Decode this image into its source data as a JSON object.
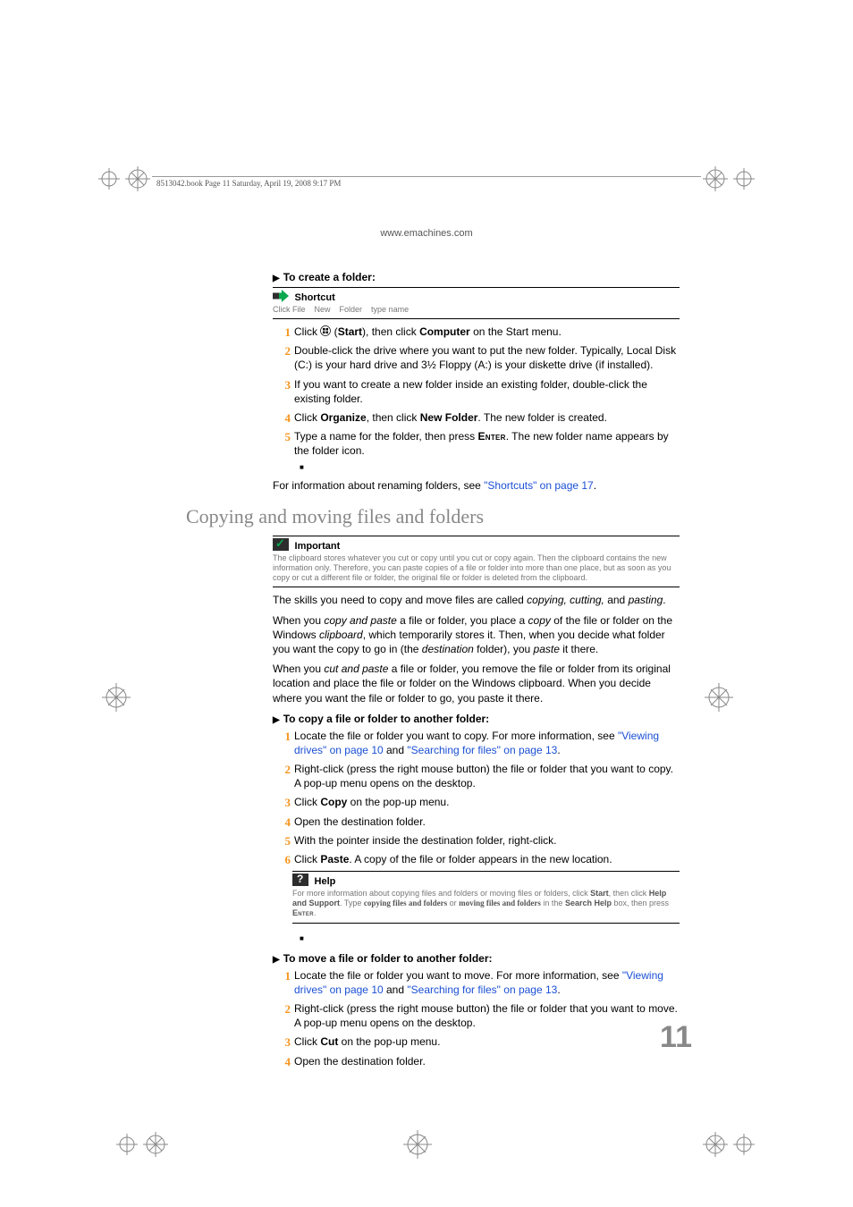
{
  "header": {
    "folio": "8513042.book  Page 11  Saturday, April 19, 2008  9:17 PM"
  },
  "url": "www.emachines.com",
  "sec1": {
    "heading": "To create a folder:",
    "shortcut": {
      "title": "Shortcut",
      "w1": "Click File",
      "w2": "New",
      "w3": "Folder",
      "w4": "type name"
    },
    "steps": {
      "s1a": "Click ",
      "s1b": " (",
      "s1c": "Start",
      "s1d": "), then click ",
      "s1e": "Computer",
      "s1f": " on the Start menu.",
      "s2": "Double-click the drive where you want to put the new folder. Typically, Local Disk (C:) is your hard drive and 3½ Floppy (A:) is your diskette drive (if installed).",
      "s3": "If you want to create a new folder inside an existing folder, double-click the existing folder.",
      "s4a": "Click ",
      "s4b": "Organize",
      "s4c": ", then click ",
      "s4d": "New Folder",
      "s4e": ". The new folder is created.",
      "s5a": "Type a name for the folder, then press ",
      "s5b": "Enter",
      "s5c": ". The new folder name appears by the folder icon."
    },
    "after_a": "For information about renaming folders, see ",
    "after_link": "\"Shortcuts\" on page 17",
    "after_b": "."
  },
  "h2": "Copying and moving files and folders",
  "important": {
    "title": "Important",
    "body": "The clipboard stores whatever you cut or copy until you cut or copy again. Then the clipboard contains the new information only. Therefore, you can paste copies of a file or folder into more than one place, but as soon as you copy or cut a different file or folder, the original file or folder is deleted from the clipboard."
  },
  "intro": {
    "p1a": "The skills you need to copy and move files are called ",
    "p1b": "copying, cutting,",
    "p1c": " and ",
    "p1d": "pasting",
    "p1e": ".",
    "p2a": "When you ",
    "p2b": "copy and paste",
    "p2c": " a file or folder, you place a ",
    "p2d": "copy",
    "p2e": " of the file or folder on the Windows ",
    "p2f": "clipboard",
    "p2g": ", which temporarily stores it. Then, when you decide what folder you want the copy to go in (the ",
    "p2h": "destination",
    "p2i": " folder), you ",
    "p2j": "paste",
    "p2k": " it there.",
    "p3a": "When you ",
    "p3b": "cut and paste",
    "p3c": " a file or folder, you remove the file or folder from its original location and place the file or folder on the Windows clipboard. When you decide where you want the file or folder to go, you paste it there."
  },
  "sec2": {
    "heading": "To copy a file or folder to another folder:",
    "s1a": "Locate the file or folder you want to copy. For more information, see ",
    "s1l1": "\"Viewing drives\" on page 10",
    "s1b": " and ",
    "s1l2": "\"Searching for files\" on page 13",
    "s1c": ".",
    "s2": "Right-click (press the right mouse button) the file or folder that you want to copy. A pop-up menu opens on the desktop.",
    "s3a": "Click ",
    "s3b": "Copy",
    "s3c": " on the pop-up menu.",
    "s4": "Open the destination folder.",
    "s5": "With the pointer inside the destination folder, right-click.",
    "s6a": "Click ",
    "s6b": "Paste",
    "s6c": ". A copy of the file or folder appears in the new location."
  },
  "help": {
    "title": "Help",
    "b1": "For more information about copying files and folders or moving files or folders, click ",
    "b2": "Start",
    "b3": ", then click ",
    "b4": "Help and Support",
    "b5": ". Type ",
    "b6": "copying files and folders",
    "b7": " or ",
    "b8": "moving files and folders",
    "b9": " in the ",
    "b10": "Search Help",
    "b11": " box, then press ",
    "b12": "Enter",
    "b13": "."
  },
  "sec3": {
    "heading": "To move a file or folder to another folder:",
    "s1a": "Locate the file or folder you want to move. For more information, see ",
    "s1l1": "\"Viewing drives\" on page 10",
    "s1b": " and ",
    "s1l2": "\"Searching for files\" on page 13",
    "s1c": ".",
    "s2": "Right-click (press the right mouse button) the file or folder that you want to move. A pop-up menu opens on the desktop.",
    "s3a": "Click ",
    "s3b": "Cut",
    "s3c": " on the pop-up menu.",
    "s4": "Open the destination folder."
  },
  "pagenum": "11"
}
